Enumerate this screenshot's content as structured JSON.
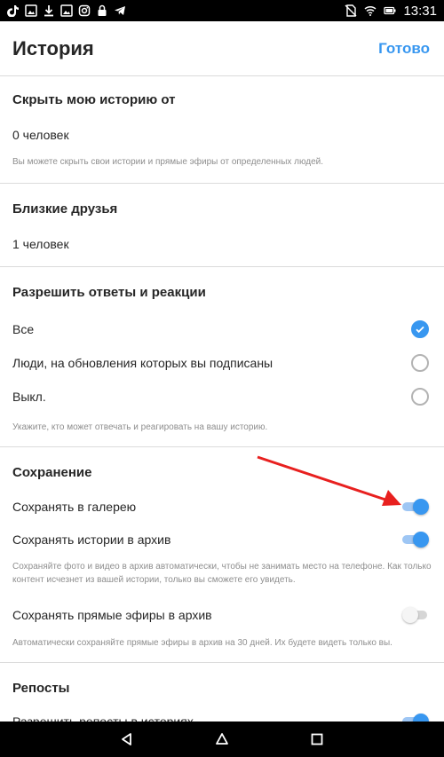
{
  "status_bar": {
    "time": "13:31",
    "left_icons": [
      "tiktok-icon",
      "gallery-icon",
      "download-icon",
      "gallery-icon",
      "instagram-icon",
      "lock-icon",
      "telegram-icon"
    ],
    "right_icons": [
      "no-sim-icon",
      "wifi-icon",
      "battery-icon"
    ]
  },
  "header": {
    "title": "История",
    "done_label": "Готово"
  },
  "hide_story": {
    "title": "Скрыть мою историю от",
    "value": "0 человек",
    "hint": "Вы можете скрыть свои истории и прямые эфиры от определенных людей."
  },
  "close_friends": {
    "title": "Близкие друзья",
    "value": "1 человек"
  },
  "replies": {
    "title": "Разрешить ответы и реакции",
    "options": [
      {
        "label": "Все",
        "selected": true
      },
      {
        "label": "Люди, на обновления которых вы подписаны",
        "selected": false
      },
      {
        "label": "Выкл.",
        "selected": false
      }
    ],
    "hint": "Укажите, кто может отвечать и реагировать на вашу историю."
  },
  "saving": {
    "title": "Сохранение",
    "gallery_label": "Сохранять в галерею",
    "gallery_on": true,
    "archive_label": "Сохранять истории в архив",
    "archive_on": true,
    "archive_hint": "Сохраняйте фото и видео в архив автоматически, чтобы не занимать место на телефоне. Как только контент исчезнет из вашей истории, только вы сможете его увидеть.",
    "live_label": "Сохранять прямые эфиры в архив",
    "live_on": false,
    "live_hint": "Автоматически сохраняйте прямые эфиры в архив на 30 дней. Их будете видеть только вы."
  },
  "reposts": {
    "title": "Репосты",
    "row_label": "Разрешить репосты в историях",
    "row_on": true
  },
  "colors": {
    "accent": "#3897f0",
    "arrow": "#e8201f",
    "divider": "#dbdbdb"
  },
  "nav_bar": {
    "icons": [
      "back-icon",
      "home-icon",
      "recents-icon"
    ]
  }
}
